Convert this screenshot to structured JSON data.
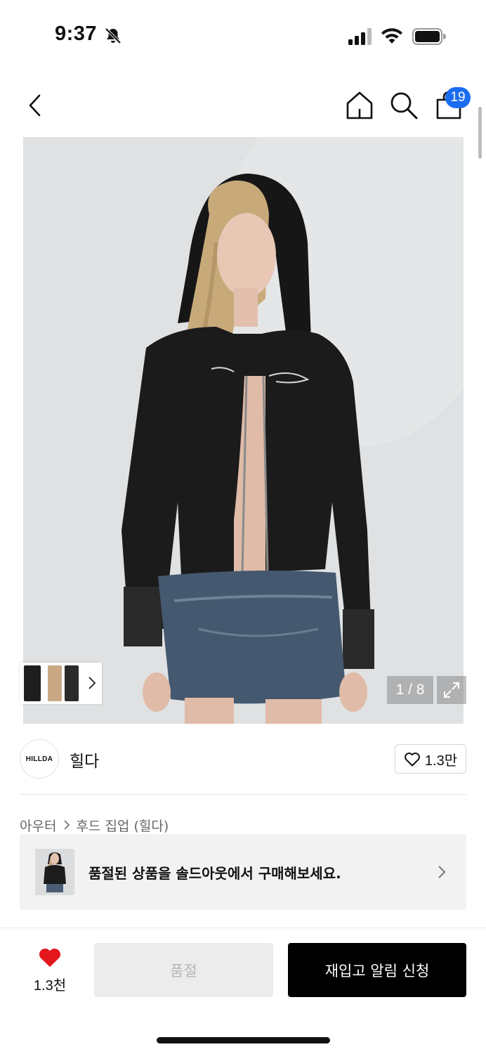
{
  "status_bar": {
    "time": "9:37",
    "icons": [
      "bell-slash-icon",
      "cellular-signal-icon",
      "wifi-icon",
      "battery-icon"
    ]
  },
  "nav": {
    "icons": [
      "back-chevron-icon",
      "home-icon",
      "search-icon",
      "shopping-bag-icon"
    ],
    "cart_count": "19"
  },
  "gallery": {
    "page_counter": "1 / 8",
    "current_page": 1,
    "total_pages": 8,
    "icons": [
      "thumbnail-next-chevron-icon",
      "expand-icon"
    ]
  },
  "brand": {
    "logo_text": "HILLDA",
    "name": "힐다",
    "like_count": "1.3만"
  },
  "breadcrumb": {
    "category": "아우터",
    "subcategory": "후드 집업 (힐다)"
  },
  "soldout_banner": {
    "text": "품절된 상품을 솔드아웃에서 구매해보세요."
  },
  "bottom_bar": {
    "favorite_count": "1.3천",
    "soldout_label": "품절",
    "restock_label": "재입고 알림 신청"
  },
  "colors": {
    "accent_blue": "#1a6cf0",
    "heart_red": "#e4161d",
    "primary_button": "#000000",
    "disabled_button": "#ececec"
  }
}
